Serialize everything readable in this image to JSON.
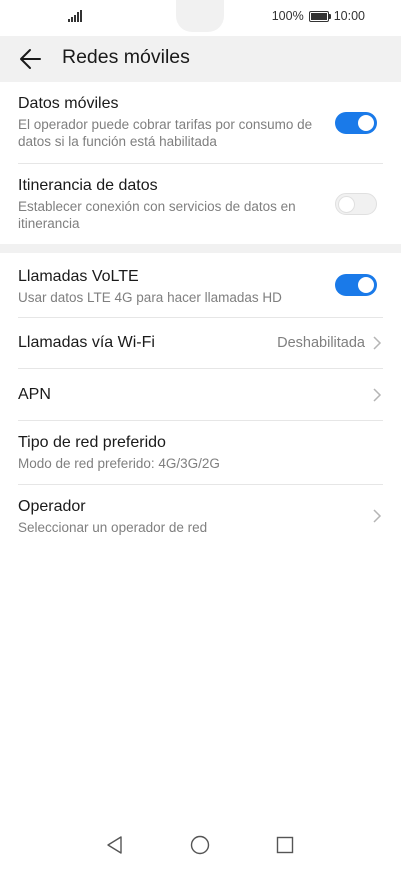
{
  "status_bar": {
    "battery_percent": "100%",
    "time": "10:00"
  },
  "header": {
    "title": "Redes móviles"
  },
  "settings": {
    "datos_moviles": {
      "title": "Datos móviles",
      "subtitle": "El operador puede cobrar tarifas por consumo de datos si la función está habilitada",
      "toggle": true
    },
    "itinerancia": {
      "title": "Itinerancia de datos",
      "subtitle": "Establecer conexión con servicios de datos en itinerancia",
      "toggle": false
    },
    "volte": {
      "title": "Llamadas VoLTE",
      "subtitle": "Usar datos LTE 4G para hacer llamadas HD",
      "toggle": true
    },
    "wifi_calls": {
      "title": "Llamadas vía Wi-Fi",
      "value": "Deshabilitada"
    },
    "apn": {
      "title": "APN"
    },
    "tipo_red": {
      "title": "Tipo de red preferido",
      "subtitle": "Modo de red preferido: 4G/3G/2G"
    },
    "operador": {
      "title": "Operador",
      "subtitle": "Seleccionar un operador de red"
    }
  },
  "colors": {
    "accent": "#1a7ae9",
    "secondary_text": "#7f7f7f",
    "band": "#f1f1f1"
  },
  "icons": {
    "back": "arrow-left-icon",
    "signal": "signal-icon",
    "battery": "battery-icon",
    "chevron": "chevron-right-icon",
    "nav_back": "triangle-back-icon",
    "nav_home": "circle-home-icon",
    "nav_recents": "square-recents-icon"
  }
}
